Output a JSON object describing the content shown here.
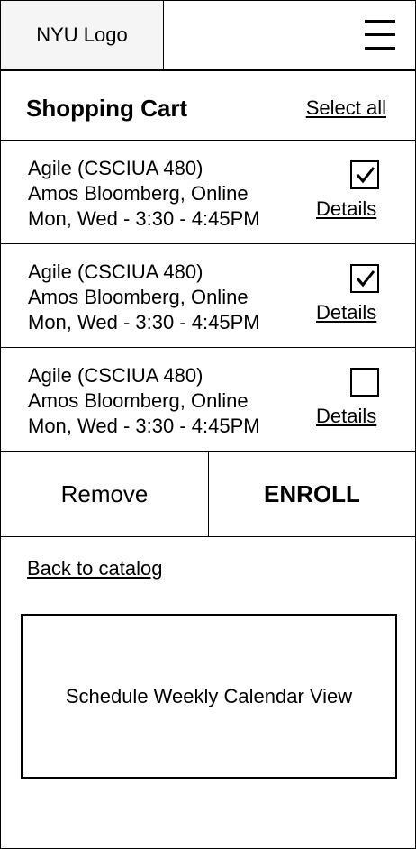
{
  "header": {
    "logo_text": "NYU Logo",
    "menu_icon": "hamburger-menu-icon"
  },
  "cart": {
    "title": "Shopping Cart",
    "select_all_label": "Select all"
  },
  "courses": [
    {
      "name": "Agile (CSCIUA 480)",
      "instructor": "Amos Bloomberg, Online",
      "schedule": "Mon, Wed - 3:30 - 4:45PM",
      "checked": true,
      "details_label": "Details"
    },
    {
      "name": "Agile (CSCIUA 480)",
      "instructor": "Amos Bloomberg, Online",
      "schedule": "Mon, Wed - 3:30 - 4:45PM",
      "checked": true,
      "details_label": "Details"
    },
    {
      "name": "Agile (CSCIUA 480)",
      "instructor": "Amos Bloomberg, Online",
      "schedule": "Mon, Wed - 3:30 - 4:45PM",
      "checked": false,
      "details_label": "Details"
    }
  ],
  "actions": {
    "remove_label": "Remove",
    "enroll_label": "ENROLL"
  },
  "navigation": {
    "back_label": "Back to catalog"
  },
  "calendar": {
    "label": "Schedule Weekly Calendar View"
  }
}
